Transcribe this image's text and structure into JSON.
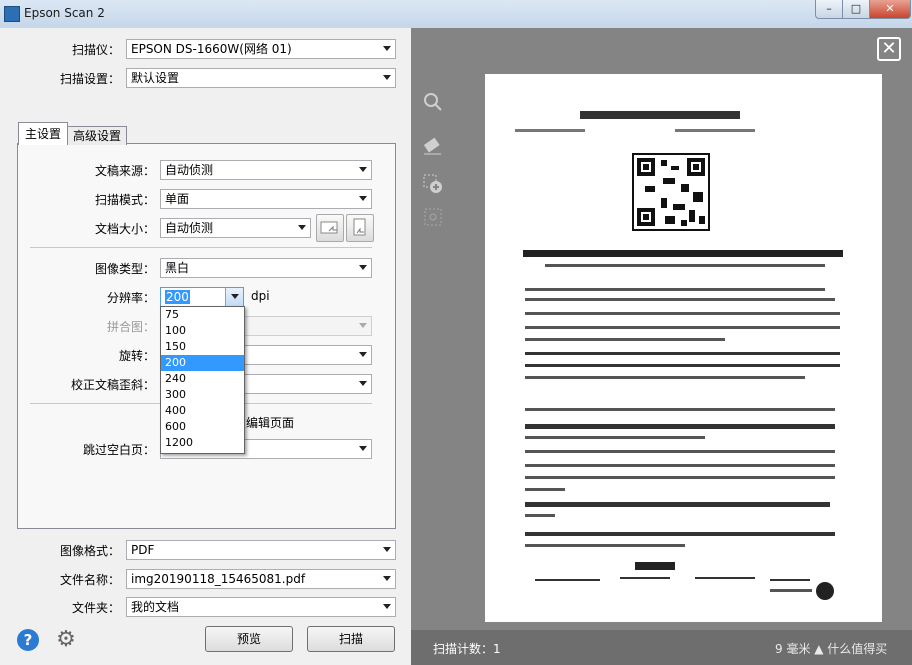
{
  "window": {
    "title": "Epson Scan 2"
  },
  "scanner": {
    "label": "扫描仪：",
    "value": "EPSON DS-1660W(网络 01)"
  },
  "scan_settings": {
    "label": "扫描设置：",
    "value": "默认设置"
  },
  "tabs": {
    "main": "主设置",
    "advanced": "高级设置"
  },
  "main": {
    "doc_source": {
      "label": "文稿来源：",
      "value": "自动侦测"
    },
    "scan_mode": {
      "label": "扫描模式：",
      "value": "单面"
    },
    "doc_size": {
      "label": "文档大小：",
      "value": "自动侦测"
    },
    "image_type": {
      "label": "图像类型：",
      "value": "黑白"
    },
    "resolution": {
      "label": "分辨率：",
      "value": "200",
      "unit": "dpi",
      "options": [
        "75",
        "100",
        "150",
        "200",
        "240",
        "300",
        "400",
        "600",
        "1200"
      ],
      "selected": "200"
    },
    "stitch": {
      "label": "拼合图："
    },
    "rotate": {
      "label": "旋转："
    },
    "deskew": {
      "label": "校正文稿歪斜："
    },
    "edit_pages": {
      "label": "编辑页面"
    },
    "skip_blank": {
      "label": "跳过空白页："
    }
  },
  "image_format": {
    "label": "图像格式：",
    "value": "PDF"
  },
  "file_name": {
    "label": "文件名称：",
    "value": "img20190118_15465081.pdf"
  },
  "folder": {
    "label": "文件夹：",
    "value": "我的文档"
  },
  "buttons": {
    "preview": "预览",
    "scan": "扫描"
  },
  "preview": {
    "scan_count": "扫描计数：1"
  },
  "status": {
    "right_text": "9 毫米 ▲ 什么值得买"
  },
  "colors": {
    "accent": "#3399ff",
    "preview_bg": "#848484"
  }
}
